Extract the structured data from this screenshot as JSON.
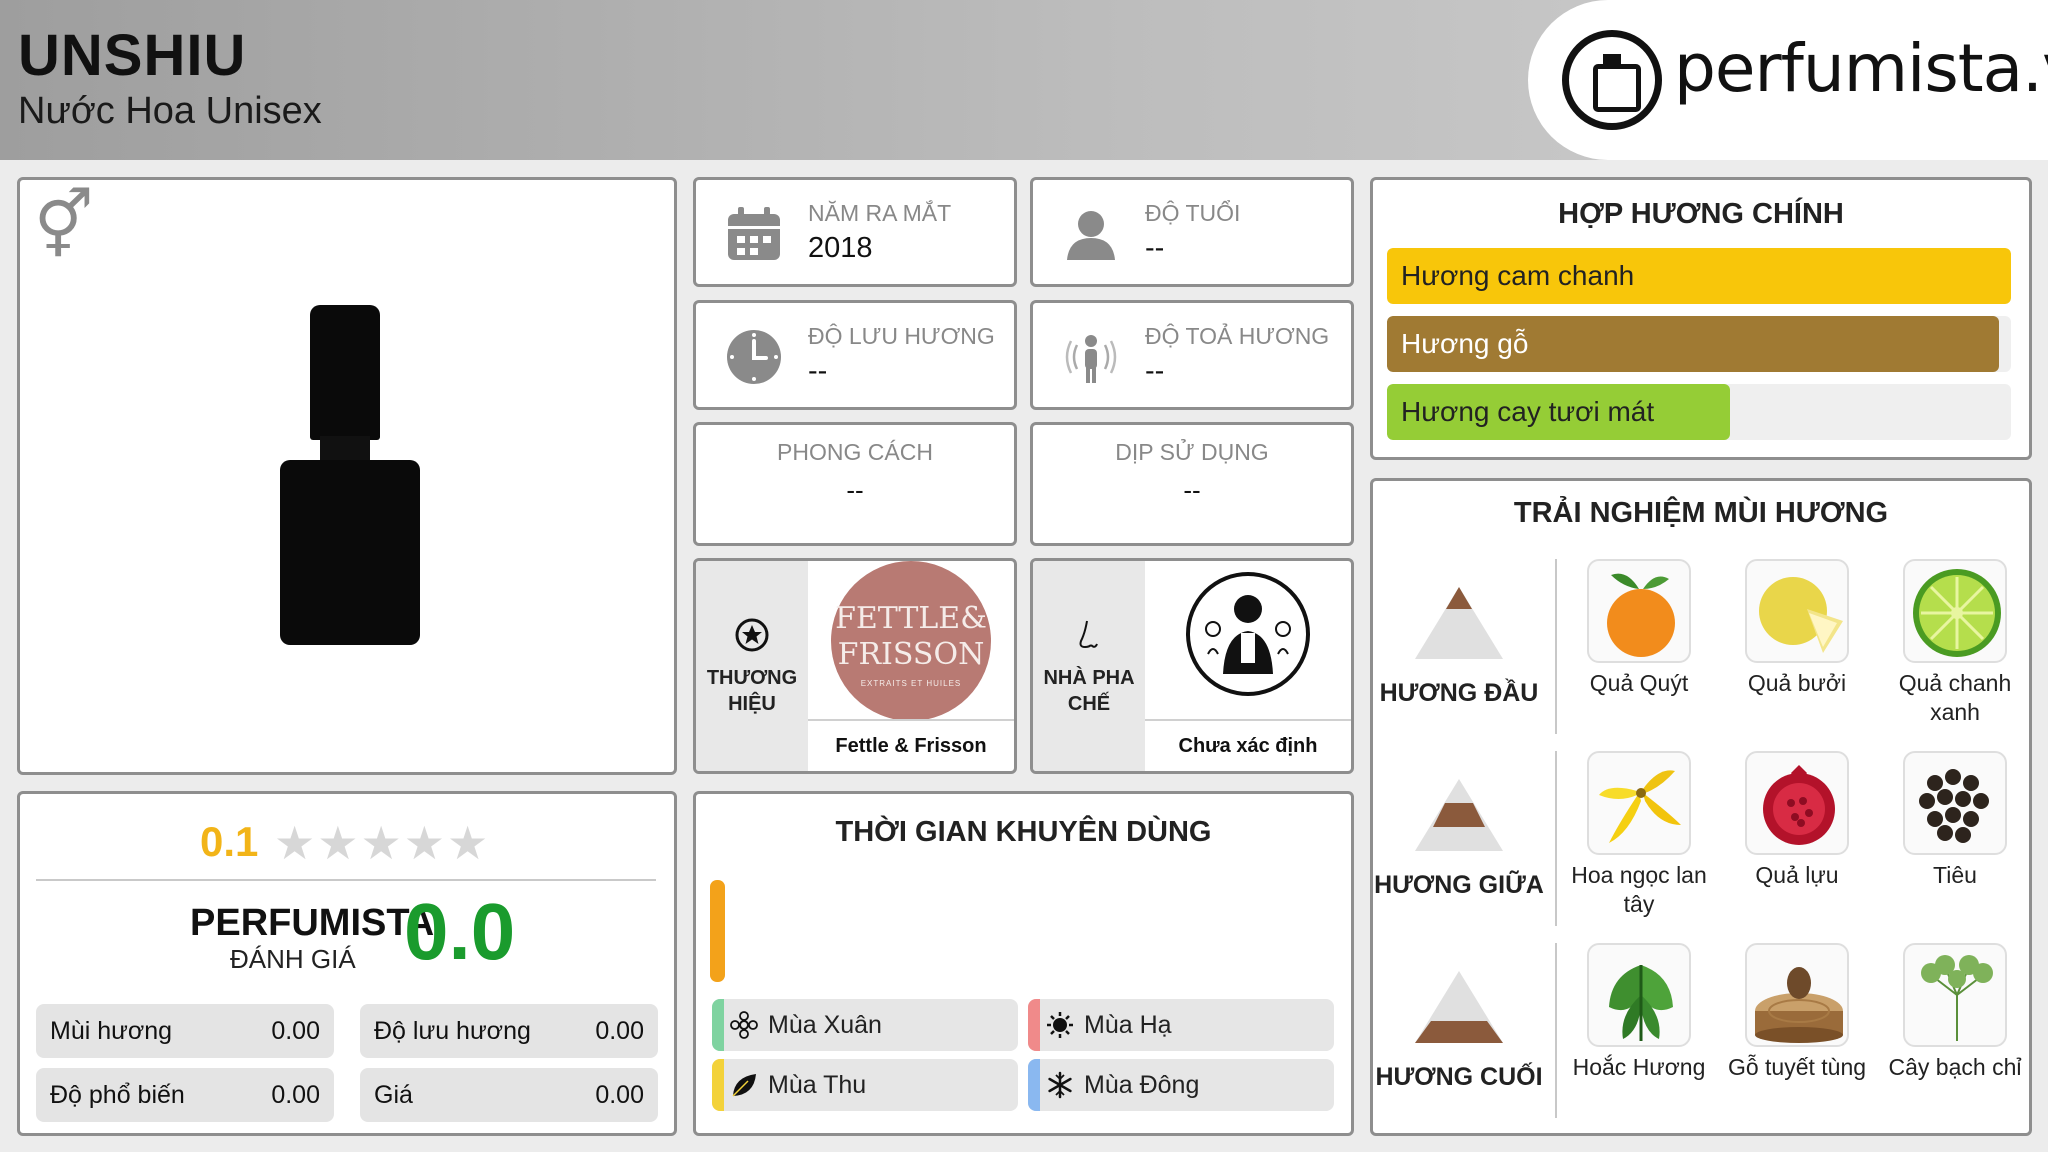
{
  "header": {
    "name": "UNSHIU",
    "subtitle": "Nước Hoa Unisex",
    "site_logo": "perfumista.vn"
  },
  "gender_icon": "unisex-gender-icon",
  "rating": {
    "user_score": "0.1",
    "stars_text": "★★★★★",
    "brand_label": "PERFUMISTA",
    "eval_label": "ĐÁNH GIÁ",
    "pf_score": "0.0",
    "metrics": [
      {
        "label": "Mùi hương",
        "value": "0.00"
      },
      {
        "label": "Độ lưu hương",
        "value": "0.00"
      },
      {
        "label": "Độ phổ biến",
        "value": "0.00"
      },
      {
        "label": "Giá",
        "value": "0.00"
      }
    ]
  },
  "info": {
    "launch": {
      "label": "NĂM RA MẮT",
      "value": "2018"
    },
    "age": {
      "label": "ĐỘ TUỔI",
      "value": "--"
    },
    "longevity": {
      "label": "ĐỘ LƯU HƯƠNG",
      "value": "--"
    },
    "sillage": {
      "label": "ĐỘ TOẢ HƯƠNG",
      "value": "--"
    },
    "style": {
      "label": "PHONG CÁCH",
      "value": "--"
    },
    "occasion": {
      "label": "DỊP SỬ DỤNG",
      "value": "--"
    },
    "brand": {
      "label": "THƯƠNG HIỆU",
      "logo_line1": "FETTLE&",
      "logo_line2": "FRISSON",
      "logo_small": "EXTRAITS ET HUILES",
      "name": "Fettle & Frisson"
    },
    "perfumer": {
      "label": "NHÀ PHA CHẾ",
      "name": "Chưa xác định"
    }
  },
  "seasons": {
    "title": "THỜI GIAN KHUYÊN DÙNG",
    "time_level": 1.0,
    "items": [
      {
        "label": "Mùa Xuân",
        "color": "#7fd3a0",
        "icon": "flower-icon"
      },
      {
        "label": "Mùa Hạ",
        "color": "#f08a8a",
        "icon": "sun-icon"
      },
      {
        "label": "Mùa Thu",
        "color": "#f3d23a",
        "icon": "leaf-icon"
      },
      {
        "label": "Mùa Đông",
        "color": "#8ab8f0",
        "icon": "snowflake-icon"
      }
    ]
  },
  "accords": {
    "title": "HỢP HƯƠNG CHÍNH",
    "items": [
      {
        "label": "Hương cam chanh",
        "level": 1.0,
        "color": "#f8c60a",
        "text_color": "#222222"
      },
      {
        "label": "Hương gỗ",
        "level": 0.98,
        "color": "#a07a33",
        "text_color": "#ffffff"
      },
      {
        "label": "Hương cay tươi mát",
        "level": 0.55,
        "color": "#95cd36",
        "text_color": "#222222"
      }
    ]
  },
  "notes": {
    "title": "TRẢI NGHIỆM MÙI HƯƠNG",
    "top": {
      "label": "HƯƠNG ĐẦU",
      "items": [
        "Quả Quýt",
        "Quả bưởi",
        "Quả chanh xanh"
      ]
    },
    "middle": {
      "label": "HƯƠNG GIỮA",
      "items": [
        "Hoa ngọc lan tây",
        "Quả lựu",
        "Tiêu"
      ]
    },
    "base": {
      "label": "HƯƠNG CUỐI",
      "items": [
        "Hoắc Hương",
        "Gỗ tuyết tùng",
        "Cây bạch chỉ"
      ]
    }
  }
}
